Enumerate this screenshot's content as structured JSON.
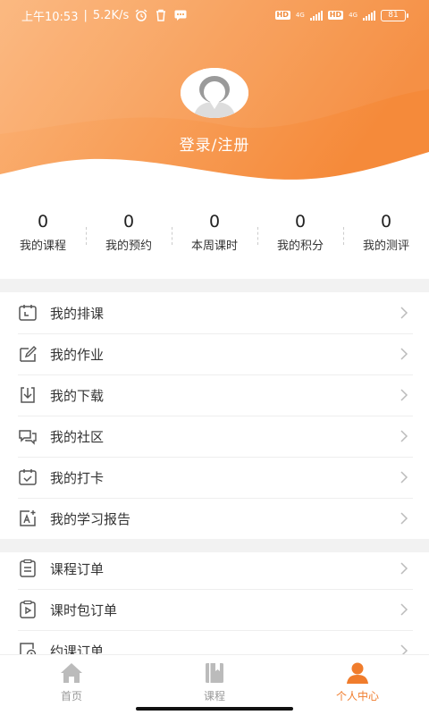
{
  "status_bar": {
    "time": "上午10:53",
    "speed": "5.2K/s",
    "hd": "HD",
    "network": "4G",
    "battery": "81"
  },
  "profile": {
    "login_label": "登录/注册"
  },
  "stats": [
    {
      "value": "0",
      "label": "我的课程"
    },
    {
      "value": "0",
      "label": "我的预约"
    },
    {
      "value": "0",
      "label": "本周课时"
    },
    {
      "value": "0",
      "label": "我的积分"
    },
    {
      "value": "0",
      "label": "我的测评"
    }
  ],
  "menu_group_1": [
    {
      "label": "我的排课",
      "icon": "calendar-icon"
    },
    {
      "label": "我的作业",
      "icon": "edit-icon"
    },
    {
      "label": "我的下载",
      "icon": "download-icon"
    },
    {
      "label": "我的社区",
      "icon": "chat-icon"
    },
    {
      "label": "我的打卡",
      "icon": "check-in-icon"
    },
    {
      "label": "我的学习报告",
      "icon": "report-icon"
    }
  ],
  "menu_group_2": [
    {
      "label": "课程订单",
      "icon": "clipboard-icon"
    },
    {
      "label": "课时包订单",
      "icon": "video-icon"
    },
    {
      "label": "约课订单",
      "icon": "appointment-icon"
    }
  ],
  "bottom_nav": [
    {
      "label": "首页",
      "icon": "home-icon"
    },
    {
      "label": "课程",
      "icon": "book-icon"
    },
    {
      "label": "个人中心",
      "icon": "user-icon"
    }
  ],
  "colors": {
    "accent": "#f07c2c",
    "header_gradient_start": "#fbb77b",
    "header_gradient_end": "#f58a3a"
  }
}
